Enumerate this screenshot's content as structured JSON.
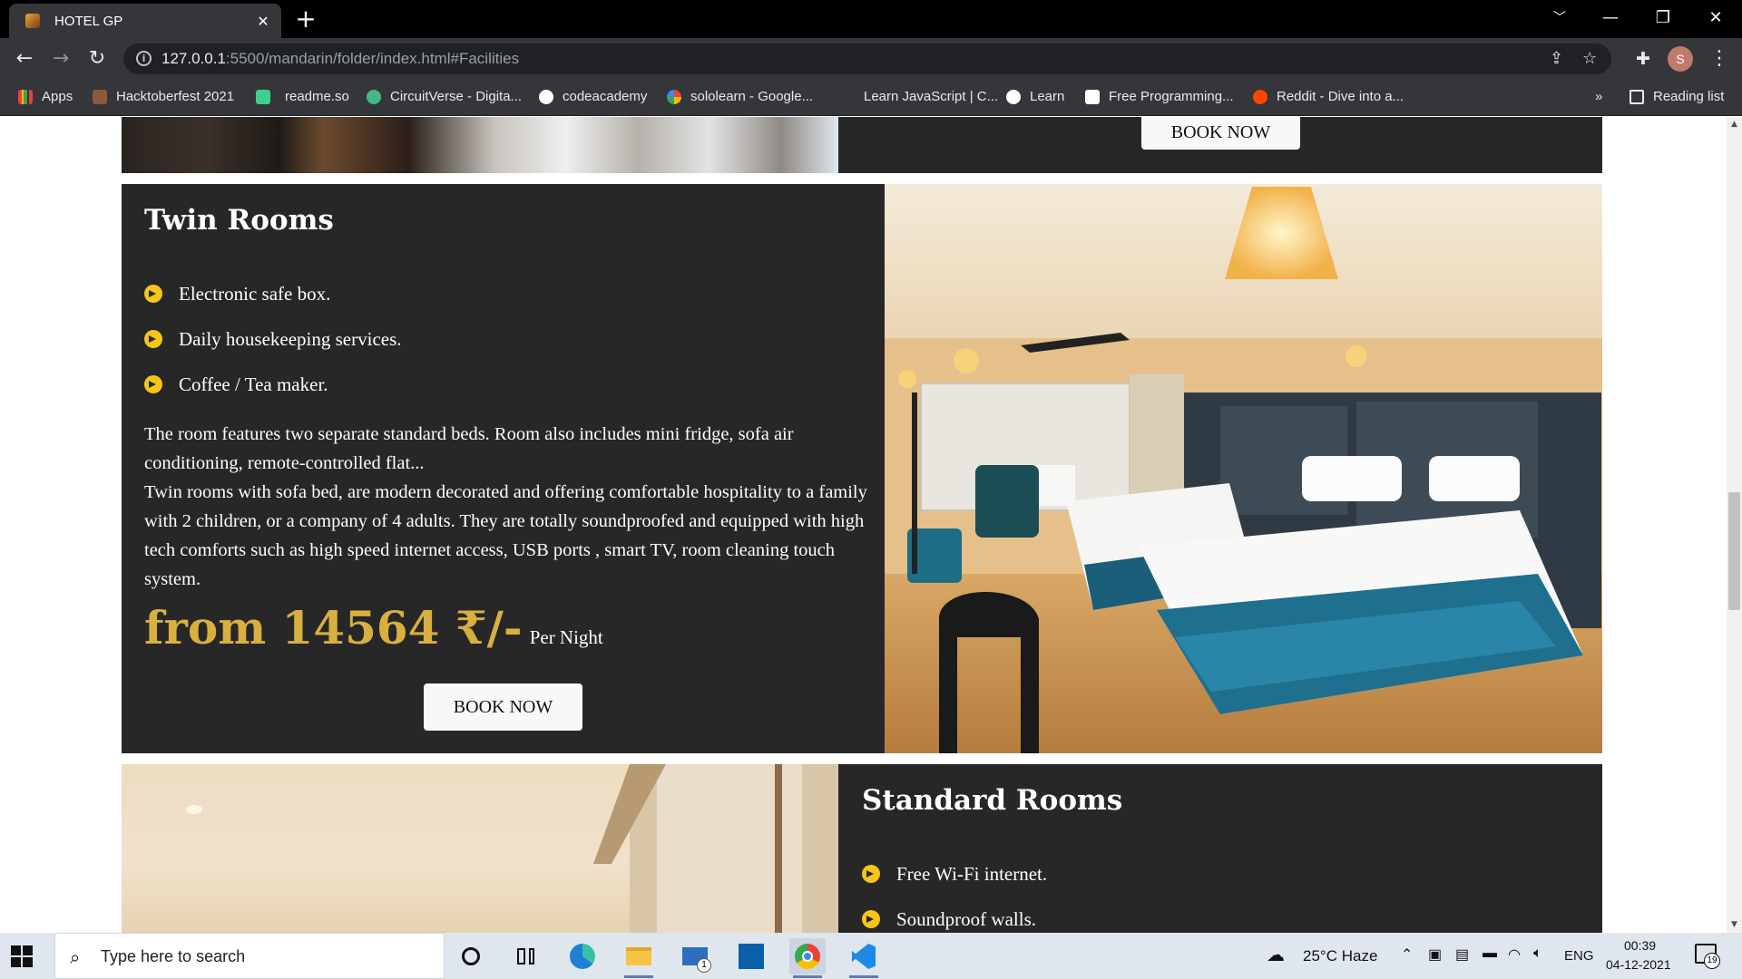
{
  "browser": {
    "tab_title": "HOTEL GP",
    "tab_close": "✕",
    "new_tab": "+",
    "url_host": "127.0.0.1",
    "url_path": ":5500/mandarin/folder/index.html#Facilities",
    "window_buttons": [
      "﹀",
      "—",
      "❐",
      "✕"
    ],
    "profile_initial": "S"
  },
  "bookmarks": {
    "items": [
      {
        "label": "Apps",
        "color": "#4285f4"
      },
      {
        "label": "Hacktoberfest 2021",
        "color": "#8a5a3a"
      },
      {
        "label": "readme.so",
        "color": "#3ecf8e"
      },
      {
        "label": "CircuitVerse - Digita...",
        "color": "#42b983"
      },
      {
        "label": "codeacademy",
        "color": "#ffffff"
      },
      {
        "label": "sololearn - Google...",
        "color": "#ffffff"
      },
      {
        "label": "Learn JavaScript | C...",
        "color": "#35363a"
      },
      {
        "label": "Learn",
        "color": "#ffffff"
      },
      {
        "label": "Free Programming...",
        "color": "#ffffff"
      },
      {
        "label": "Reddit - Dive into a...",
        "color": "#ff4500"
      }
    ],
    "overflow": "»",
    "reading_list": "Reading list"
  },
  "page": {
    "prev_card": {
      "button": "BOOK NOW"
    },
    "twin": {
      "title": "Twin Rooms",
      "features": [
        "Electronic safe box.",
        "Daily housekeeping services.",
        "Coffee / Tea maker."
      ],
      "description_1": "The room features two separate standard beds. Room also includes mini fridge, sofa air conditioning, remote-controlled flat...",
      "description_2": "Twin rooms with sofa bed, are modern decorated and offering comfortable hospitality to a family with 2 children, or a company of 4 adults. They are totally soundproofed and equipped with high tech comforts such as high speed internet access, USB ports , smart TV, room cleaning touch system.",
      "price": "from 14564 ₹/-",
      "per_night": "Per Night",
      "button": "BOOK NOW"
    },
    "standard": {
      "title": "Standard Rooms",
      "features": [
        "Free Wi-Fi internet.",
        "Soundproof walls."
      ]
    }
  },
  "taskbar": {
    "search_placeholder": "Type here to search",
    "weather": "25°C  Haze",
    "language": "ENG",
    "time": "00:39",
    "date": "04-12-2021",
    "notification_count": "19",
    "mail_badge": "1"
  },
  "colors": {
    "card_bg": "#282727",
    "price_gold": "#d7b040",
    "bullet_yellow": "#f5c518"
  }
}
